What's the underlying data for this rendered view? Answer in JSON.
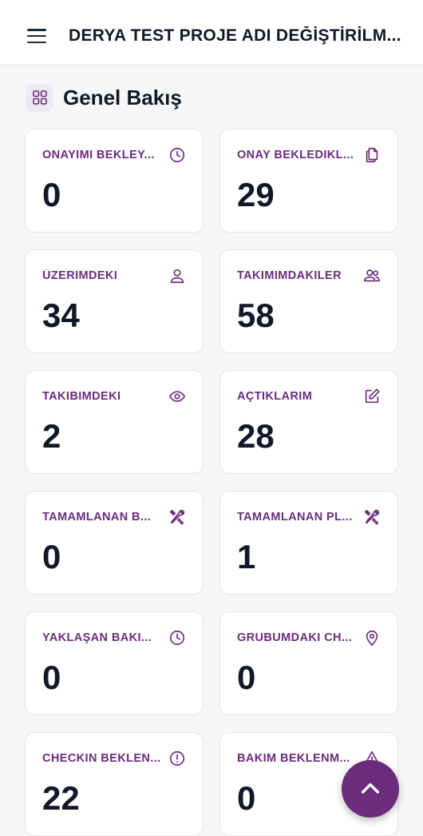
{
  "header": {
    "menu_icon": "hamburger-menu-icon",
    "project_title": "DERYA TEST PROJE ADI DEĞİŞTİRİLM..."
  },
  "overview": {
    "title": "Genel Bakış",
    "icon": "grid-icon"
  },
  "colors": {
    "accent": "#6b2c7c",
    "card_background": "#ffffff",
    "page_background": "#f6f7f9"
  },
  "cards": [
    {
      "label": "ONAYIMI BEKLEY...",
      "value": "0",
      "icon": "clock-icon"
    },
    {
      "label": "ONAY BEKLEDIKL...",
      "value": "29",
      "icon": "documents-icon"
    },
    {
      "label": "ÜZERIMDEKI",
      "value": "34",
      "icon": "user-icon"
    },
    {
      "label": "TAKIMIMDAKILER",
      "value": "58",
      "icon": "users-icon"
    },
    {
      "label": "TAKIBIMDEKI",
      "value": "2",
      "icon": "eye-icon"
    },
    {
      "label": "AÇTIKLARIM",
      "value": "28",
      "icon": "edit-icon"
    },
    {
      "label": "TAMAMLANAN B...",
      "value": "0",
      "icon": "tools-icon"
    },
    {
      "label": "TAMAMLANAN PL...",
      "value": "1",
      "icon": "tools-icon"
    },
    {
      "label": "YAKLAŞAN BAKI...",
      "value": "0",
      "icon": "clock-icon"
    },
    {
      "label": "GRUBUMDAKI CH...",
      "value": "0",
      "icon": "location-pin-icon"
    },
    {
      "label": "CHECKIN BEKLEN...",
      "value": "22",
      "icon": "alert-circle-icon"
    },
    {
      "label": "BAKIM BEKLENM...",
      "value": "0",
      "icon": "warning-triangle-icon"
    }
  ],
  "fab": {
    "icon": "chevron-up-icon"
  }
}
